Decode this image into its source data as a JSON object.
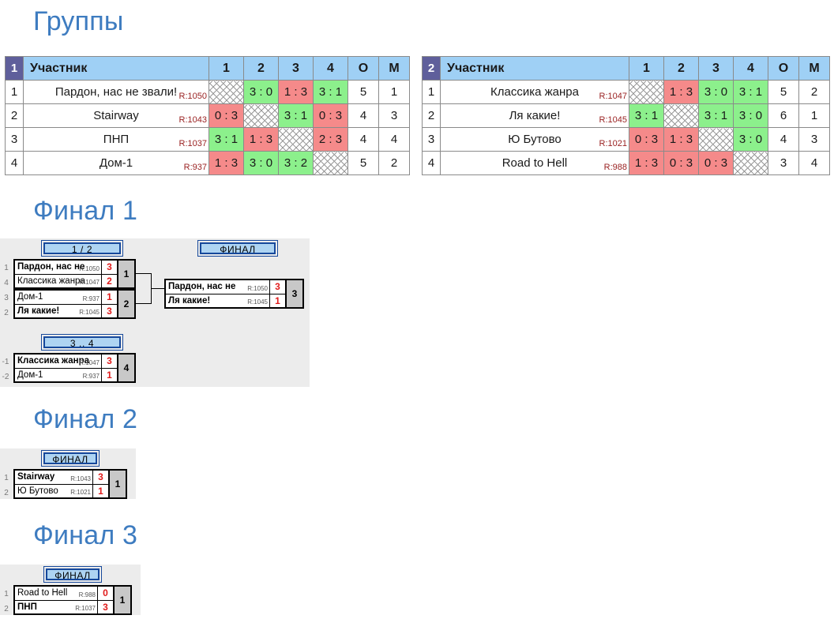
{
  "sections": {
    "groups_title": "Группы",
    "final1_title": "Финал 1",
    "final2_title": "Финал 2",
    "final3_title": "Финал 3"
  },
  "groups": [
    {
      "number": "1",
      "headers": [
        "Участник",
        "1",
        "2",
        "3",
        "4",
        "О",
        "М"
      ],
      "rows": [
        {
          "rank": "1",
          "name": "Пардон, нас не звали!",
          "rating": "R:1050",
          "scores": [
            {
              "t": "self",
              "v": ""
            },
            {
              "t": "win",
              "v": "3 : 0"
            },
            {
              "t": "loss",
              "v": "1 : 3"
            },
            {
              "t": "win",
              "v": "3 : 1"
            }
          ],
          "points": "5",
          "place": "1"
        },
        {
          "rank": "2",
          "name": "Stairway",
          "rating": "R:1043",
          "scores": [
            {
              "t": "loss",
              "v": "0 : 3"
            },
            {
              "t": "self",
              "v": ""
            },
            {
              "t": "win",
              "v": "3 : 1"
            },
            {
              "t": "loss",
              "v": "0 : 3"
            }
          ],
          "points": "4",
          "place": "3"
        },
        {
          "rank": "3",
          "name": "ПНП",
          "rating": "R:1037",
          "scores": [
            {
              "t": "win",
              "v": "3 : 1"
            },
            {
              "t": "loss",
              "v": "1 : 3"
            },
            {
              "t": "self",
              "v": ""
            },
            {
              "t": "loss",
              "v": "2 : 3"
            }
          ],
          "points": "4",
          "place": "4"
        },
        {
          "rank": "4",
          "name": "Дом-1",
          "rating": "R:937",
          "scores": [
            {
              "t": "loss",
              "v": "1 : 3"
            },
            {
              "t": "win",
              "v": "3 : 0"
            },
            {
              "t": "win",
              "v": "3 : 2"
            },
            {
              "t": "self",
              "v": ""
            }
          ],
          "points": "5",
          "place": "2"
        }
      ]
    },
    {
      "number": "2",
      "headers": [
        "Участник",
        "1",
        "2",
        "3",
        "4",
        "О",
        "М"
      ],
      "rows": [
        {
          "rank": "1",
          "name": "Классика жанра",
          "rating": "R:1047",
          "scores": [
            {
              "t": "self",
              "v": ""
            },
            {
              "t": "loss",
              "v": "1 : 3"
            },
            {
              "t": "win",
              "v": "3 : 0"
            },
            {
              "t": "win",
              "v": "3 : 1"
            }
          ],
          "points": "5",
          "place": "2"
        },
        {
          "rank": "2",
          "name": "Ля какие!",
          "rating": "R:1045",
          "scores": [
            {
              "t": "win",
              "v": "3 : 1"
            },
            {
              "t": "self",
              "v": ""
            },
            {
              "t": "win",
              "v": "3 : 1"
            },
            {
              "t": "win",
              "v": "3 : 0"
            }
          ],
          "points": "6",
          "place": "1"
        },
        {
          "rank": "3",
          "name": "Ю Бутово",
          "rating": "R:1021",
          "scores": [
            {
              "t": "loss",
              "v": "0 : 3"
            },
            {
              "t": "loss",
              "v": "1 : 3"
            },
            {
              "t": "self",
              "v": ""
            },
            {
              "t": "win",
              "v": "3 : 0"
            }
          ],
          "points": "4",
          "place": "3"
        },
        {
          "rank": "4",
          "name": "Road to Hell",
          "rating": "R:988",
          "scores": [
            {
              "t": "loss",
              "v": "1 : 3"
            },
            {
              "t": "loss",
              "v": "0 : 3"
            },
            {
              "t": "loss",
              "v": "0 : 3"
            },
            {
              "t": "self",
              "v": ""
            }
          ],
          "points": "3",
          "place": "4"
        }
      ]
    }
  ],
  "final1": {
    "round_label_semi": "1 / 2",
    "round_label_final": "ФИНАЛ",
    "round_label_third": "3 .. 4",
    "semi1": {
      "num": "1",
      "p1": {
        "seed": "1",
        "name": "Пардон, нас не",
        "rating": "R:1050",
        "score": "3",
        "winner": true
      },
      "p2": {
        "seed": "4",
        "name": "Классика жанра",
        "rating": "R:1047",
        "score": "2",
        "winner": false
      }
    },
    "semi2": {
      "num": "2",
      "p1": {
        "seed": "3",
        "name": "Дом-1",
        "rating": "R:937",
        "score": "1",
        "winner": false
      },
      "p2": {
        "seed": "2",
        "name": "Ля какие!",
        "rating": "R:1045",
        "score": "3",
        "winner": true
      }
    },
    "final": {
      "num": "3",
      "p1": {
        "seed": "",
        "name": "Пардон, нас не",
        "rating": "R:1050",
        "score": "3",
        "winner": true
      },
      "p2": {
        "seed": "",
        "name": "Ля какие!",
        "rating": "R:1045",
        "score": "1",
        "winner": false
      }
    },
    "third": {
      "num": "4",
      "p1": {
        "seed": "-1",
        "name": "Классика жанра",
        "rating": "R:1047",
        "score": "3",
        "winner": true
      },
      "p2": {
        "seed": "-2",
        "name": "Дом-1",
        "rating": "R:937",
        "score": "1",
        "winner": false
      }
    }
  },
  "final2": {
    "round_label_final": "ФИНАЛ",
    "final": {
      "num": "1",
      "p1": {
        "seed": "1",
        "name": "Stairway",
        "rating": "R:1043",
        "score": "3",
        "winner": true
      },
      "p2": {
        "seed": "2",
        "name": "Ю Бутово",
        "rating": "R:1021",
        "score": "1",
        "winner": false
      }
    }
  },
  "final3": {
    "round_label_final": "ФИНАЛ",
    "final": {
      "num": "1",
      "p1": {
        "seed": "1",
        "name": "Road to Hell",
        "rating": "R:988",
        "score": "0",
        "winner": false
      },
      "p2": {
        "seed": "2",
        "name": "ПНП",
        "rating": "R:1037",
        "score": "3",
        "winner": true
      }
    }
  },
  "colors": {
    "title": "#3e7cc0",
    "header_fill": "#9fd0f5",
    "group_num_fill": "#5f5f9b",
    "win": "#8cf08c",
    "loss": "#f58a8a",
    "score_red": "#e01b1b",
    "rating_red": "#9a2222",
    "bracket_bg": "#ececec"
  }
}
